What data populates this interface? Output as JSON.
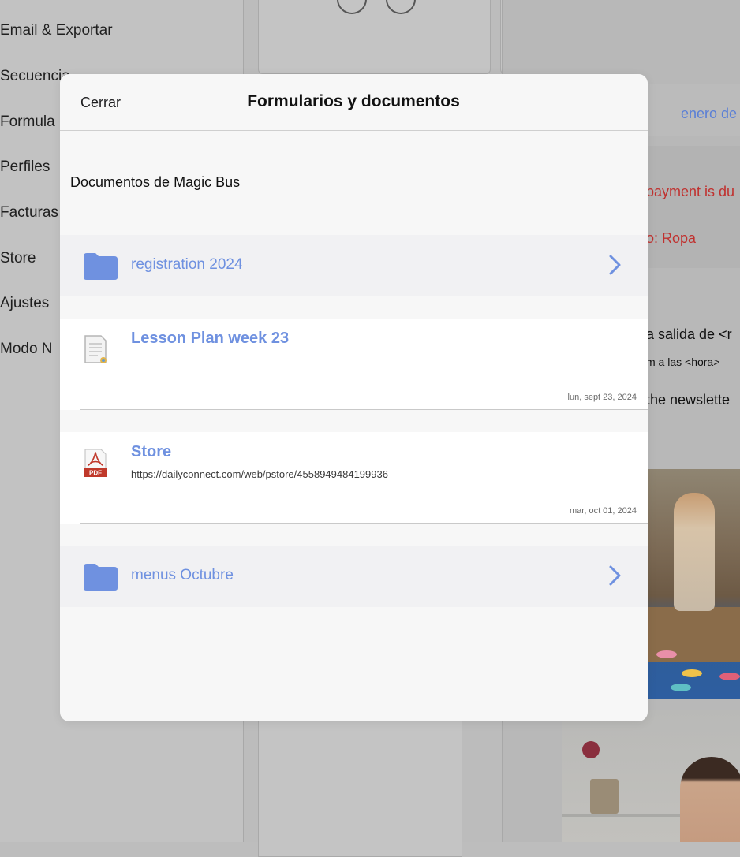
{
  "background": {
    "sidebar_items": [
      "Email & Exportar",
      "Secuencia",
      "Formula",
      "Perfiles",
      "Facturas",
      "Store",
      "Ajustes",
      "Modo N"
    ],
    "right_panel": {
      "date_label": "enero de",
      "alert_line1": "payment is du",
      "alert_line2": "o: Ropa",
      "text_line1": "a salida de <r",
      "text_line2": "m a las <hora>",
      "text_line3": "the newslette"
    },
    "colors": {
      "link": "#5a7fd6",
      "alert": "#c0312f"
    }
  },
  "modal": {
    "close_label": "Cerrar",
    "title": "Formularios y documentos",
    "section_title": "Documentos de Magic Bus",
    "items": [
      {
        "type": "folder",
        "icon": "folder-icon",
        "label": "registration 2024"
      },
      {
        "type": "document",
        "icon": "document-icon",
        "label": "Lesson Plan week 23",
        "subtitle": "",
        "date": "lun, sept 23, 2024"
      },
      {
        "type": "pdf",
        "icon": "pdf-icon",
        "label": "Store",
        "subtitle": "https://dailyconnect.com/web/pstore/4558949484199936",
        "date": "mar, oct 01, 2024"
      },
      {
        "type": "folder",
        "icon": "folder-icon",
        "label": "menus Octubre"
      }
    ],
    "pdf_badge": "PDF",
    "colors": {
      "accent": "#6f91e0",
      "folder": "#6f91e0",
      "pdf": "#c0392b"
    }
  }
}
